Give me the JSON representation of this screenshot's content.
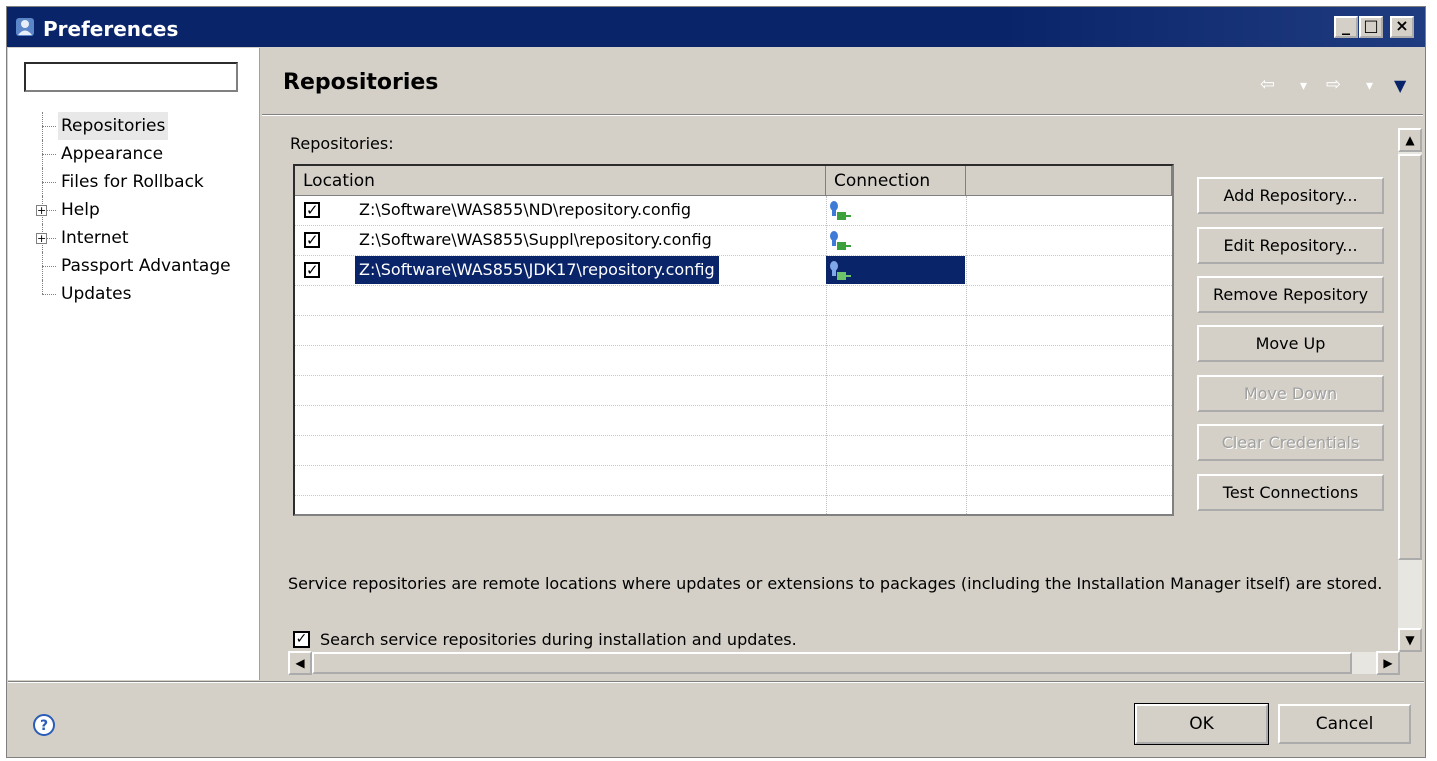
{
  "window": {
    "title": "Preferences",
    "minimize_glyph": "_",
    "maximize_glyph": "□",
    "close_glyph": "×"
  },
  "filter": {
    "value": ""
  },
  "tree": {
    "items": [
      {
        "label": "Repositories",
        "selected": true,
        "expandable": false
      },
      {
        "label": "Appearance",
        "expandable": false
      },
      {
        "label": "Files for Rollback",
        "expandable": false
      },
      {
        "label": "Help",
        "expandable": true
      },
      {
        "label": "Internet",
        "expandable": true
      },
      {
        "label": "Passport Advantage",
        "expandable": false
      },
      {
        "label": "Updates",
        "expandable": false
      }
    ]
  },
  "page": {
    "title": "Repositories",
    "back_glyph": "⇦",
    "forward_glyph": "⇨",
    "dropdown_glyph": "▾",
    "menu_glyph": "▼",
    "repositories_label": "Repositories:"
  },
  "table": {
    "headers": {
      "location": "Location",
      "connection": "Connection"
    },
    "rows": [
      {
        "checked": true,
        "location": "Z:\\Software\\WAS855\\ND\\repository.config",
        "connection_icon": "connection-ok-icon"
      },
      {
        "checked": true,
        "location": "Z:\\Software\\WAS855\\Suppl\\repository.config",
        "connection_icon": "connection-ok-icon"
      },
      {
        "checked": true,
        "location": "Z:\\Software\\WAS855\\JDK17\\repository.config",
        "connection_icon": "connection-ok-icon",
        "selected": true
      }
    ],
    "check_glyph": "✓"
  },
  "buttons": {
    "add": "Add Repository...",
    "edit": "Edit Repository...",
    "remove": "Remove Repository",
    "move_up": "Move Up",
    "move_down": "Move Down",
    "clear_credentials": "Clear Credentials",
    "test_connections": "Test Connections"
  },
  "scroll": {
    "up": "▲",
    "down": "▼",
    "left": "◀",
    "right": "▶"
  },
  "description": "Service repositories are remote locations where updates or extensions to packages (including the Installation Manager itself) are stored.",
  "search_option": {
    "label": "Search service repositories during installation and updates.",
    "checked": true,
    "glyph": "✓"
  },
  "footer": {
    "ok": "OK",
    "cancel": "Cancel",
    "help_glyph": "?"
  },
  "colors": {
    "titlebar": "#0a246a",
    "selection": "#0a246a",
    "dialog_bg": "#d4d0c8"
  }
}
